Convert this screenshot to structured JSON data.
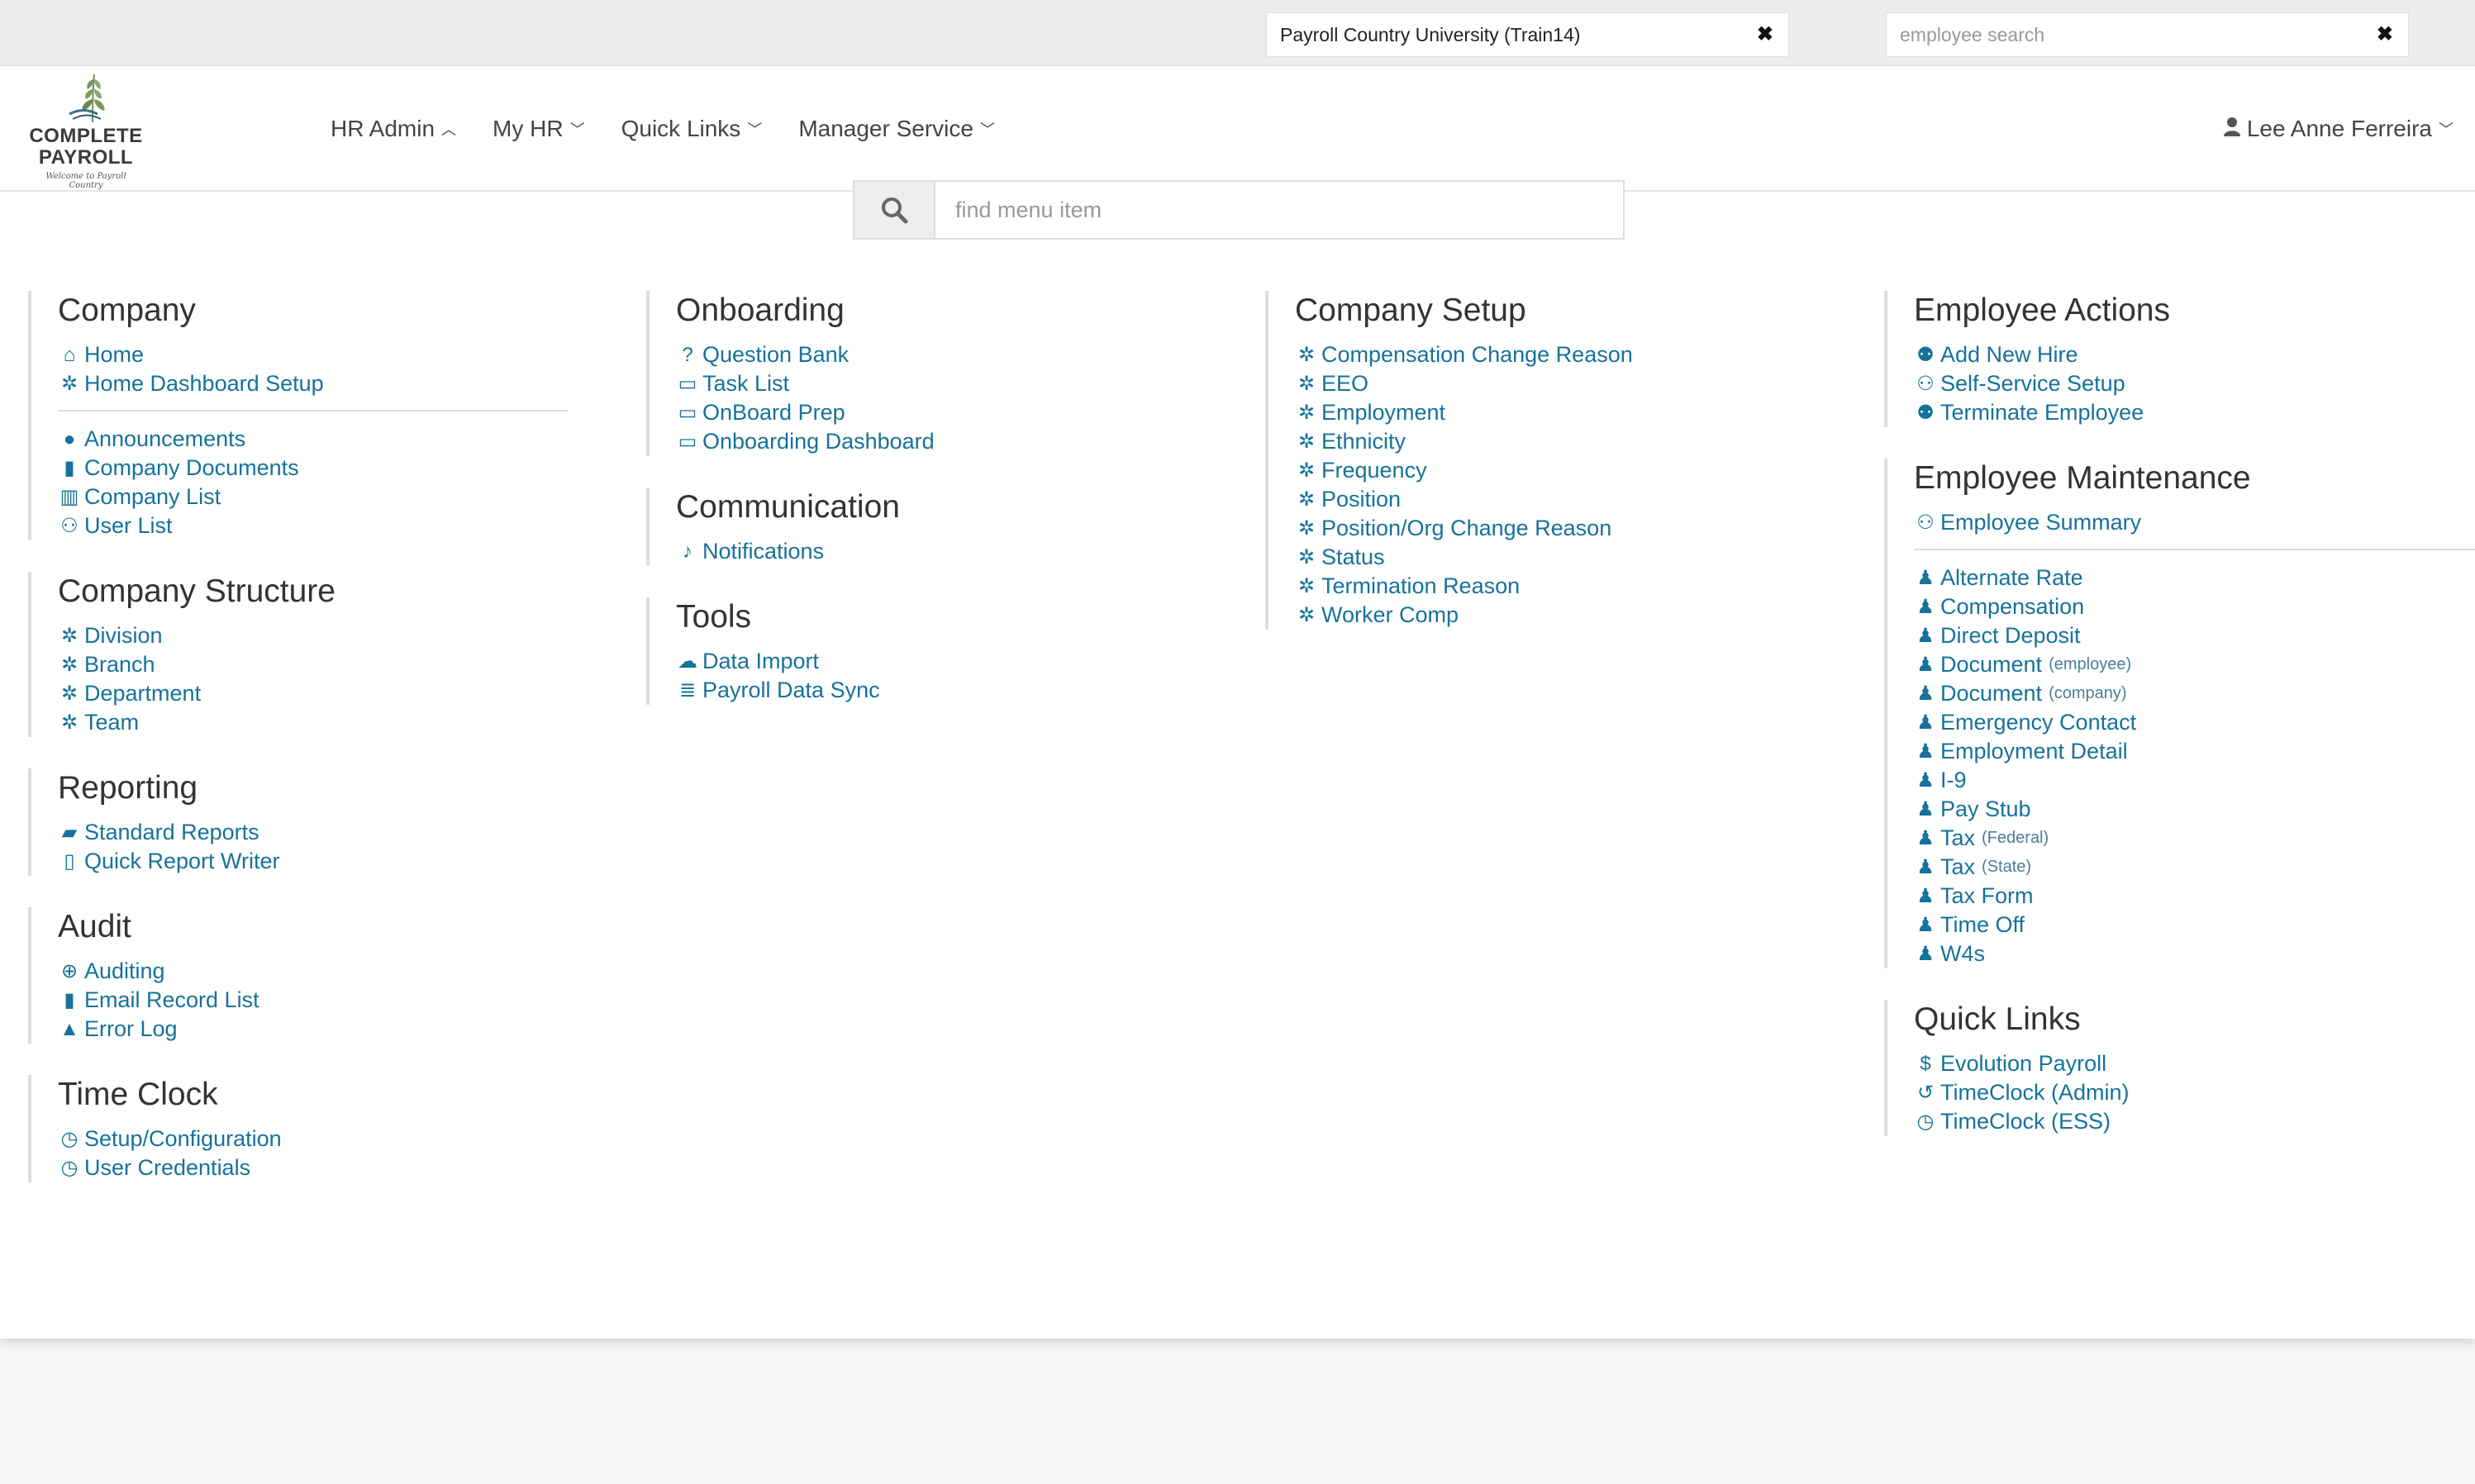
{
  "top_bar": {
    "company_selector": "Payroll Country University (Train14)",
    "employee_search_placeholder": "employee search"
  },
  "logo": {
    "line1": "COMPLETE",
    "line2": "PAYROLL",
    "tagline": "Welcome to Payroll Country"
  },
  "nav": {
    "items": [
      {
        "label": "HR Admin",
        "caret": "up"
      },
      {
        "label": "My HR",
        "caret": "down"
      },
      {
        "label": "Quick Links",
        "caret": "down"
      },
      {
        "label": "Manager Service",
        "caret": "down"
      }
    ],
    "user_name": "Lee Anne Ferreira"
  },
  "menu_search": {
    "placeholder": "find menu item"
  },
  "columns": [
    {
      "sections": [
        {
          "title": "Company",
          "groups": [
            [
              {
                "label": "Home",
                "icon": "home-icon"
              },
              {
                "label": "Home Dashboard Setup",
                "icon": "gear-icon"
              }
            ],
            [
              {
                "label": "Announcements",
                "icon": "comment-icon"
              },
              {
                "label": "Company Documents",
                "icon": "file-icon"
              },
              {
                "label": "Company List",
                "icon": "building-icon"
              },
              {
                "label": "User List",
                "icon": "users-icon"
              }
            ]
          ]
        },
        {
          "title": "Company Structure",
          "groups": [
            [
              {
                "label": "Division",
                "icon": "gear-icon"
              },
              {
                "label": "Branch",
                "icon": "gear-icon"
              },
              {
                "label": "Department",
                "icon": "gear-icon"
              },
              {
                "label": "Team",
                "icon": "gear-icon"
              }
            ]
          ]
        },
        {
          "title": "Reporting",
          "groups": [
            [
              {
                "label": "Standard Reports",
                "icon": "book-icon"
              },
              {
                "label": "Quick Report Writer",
                "icon": "excel-file-icon"
              }
            ]
          ]
        },
        {
          "title": "Audit",
          "groups": [
            [
              {
                "label": "Auditing",
                "icon": "search-plus-icon"
              },
              {
                "label": "Email Record List",
                "icon": "file-icon"
              },
              {
                "label": "Error Log",
                "icon": "warning-icon"
              }
            ]
          ]
        },
        {
          "title": "Time Clock",
          "groups": [
            [
              {
                "label": "Setup/Configuration",
                "icon": "clock-icon"
              },
              {
                "label": "User Credentials",
                "icon": "clock-icon"
              }
            ]
          ]
        }
      ]
    },
    {
      "sections": [
        {
          "title": "Onboarding",
          "groups": [
            [
              {
                "label": "Question Bank",
                "icon": "question-icon"
              },
              {
                "label": "Task List",
                "icon": "desktop-icon"
              },
              {
                "label": "OnBoard Prep",
                "icon": "desktop-icon"
              },
              {
                "label": "Onboarding Dashboard",
                "icon": "desktop-icon"
              }
            ]
          ]
        },
        {
          "title": "Communication",
          "groups": [
            [
              {
                "label": "Notifications",
                "icon": "bell-icon"
              }
            ]
          ]
        },
        {
          "title": "Tools",
          "groups": [
            [
              {
                "label": "Data Import",
                "icon": "cloud-upload-icon"
              },
              {
                "label": "Payroll Data Sync",
                "icon": "database-icon"
              }
            ]
          ]
        }
      ]
    },
    {
      "sections": [
        {
          "title": "Company Setup",
          "groups": [
            [
              {
                "label": "Compensation Change Reason",
                "icon": "gear-icon"
              },
              {
                "label": "EEO",
                "icon": "gear-icon"
              },
              {
                "label": "Employment",
                "icon": "gear-icon"
              },
              {
                "label": "Ethnicity",
                "icon": "gear-icon"
              },
              {
                "label": "Frequency",
                "icon": "gear-icon"
              },
              {
                "label": "Position",
                "icon": "gear-icon"
              },
              {
                "label": "Position/Org Change Reason",
                "icon": "gear-icon"
              },
              {
                "label": "Status",
                "icon": "gear-icon"
              },
              {
                "label": "Termination Reason",
                "icon": "gear-icon"
              },
              {
                "label": "Worker Comp",
                "icon": "gear-icon"
              }
            ]
          ]
        }
      ]
    },
    {
      "sections": [
        {
          "title": "Employee Actions",
          "groups": [
            [
              {
                "label": "Add New Hire",
                "icon": "user-plus-icon"
              },
              {
                "label": "Self-Service Setup",
                "icon": "users-icon"
              },
              {
                "label": "Terminate Employee",
                "icon": "user-times-icon"
              }
            ]
          ]
        },
        {
          "title": "Employee Maintenance",
          "groups": [
            [
              {
                "label": "Employee Summary",
                "icon": "users-icon"
              }
            ],
            [
              {
                "label": "Alternate Rate",
                "icon": "user-icon"
              },
              {
                "label": "Compensation",
                "icon": "user-icon"
              },
              {
                "label": "Direct Deposit",
                "icon": "user-icon"
              },
              {
                "label": "Document",
                "note": "(employee)",
                "icon": "user-icon"
              },
              {
                "label": "Document",
                "note": "(company)",
                "icon": "user-icon"
              },
              {
                "label": "Emergency Contact",
                "icon": "user-icon"
              },
              {
                "label": "Employment Detail",
                "icon": "user-icon"
              },
              {
                "label": "I-9",
                "icon": "user-icon"
              },
              {
                "label": "Pay Stub",
                "icon": "user-icon"
              },
              {
                "label": "Tax",
                "note": "(Federal)",
                "icon": "user-icon"
              },
              {
                "label": "Tax",
                "note": "(State)",
                "icon": "user-icon"
              },
              {
                "label": "Tax Form",
                "icon": "user-icon"
              },
              {
                "label": "Time Off",
                "icon": "user-icon"
              },
              {
                "label": "W4s",
                "icon": "user-icon"
              }
            ]
          ]
        },
        {
          "title": "Quick Links",
          "groups": [
            [
              {
                "label": "Evolution Payroll",
                "icon": "dollar-icon"
              },
              {
                "label": "TimeClock (Admin)",
                "icon": "history-icon"
              },
              {
                "label": "TimeClock (ESS)",
                "icon": "clock-icon"
              }
            ]
          ]
        }
      ]
    }
  ],
  "colors": {
    "link": "#16729b",
    "topbar": "#ececec",
    "border": "#dddddd"
  }
}
